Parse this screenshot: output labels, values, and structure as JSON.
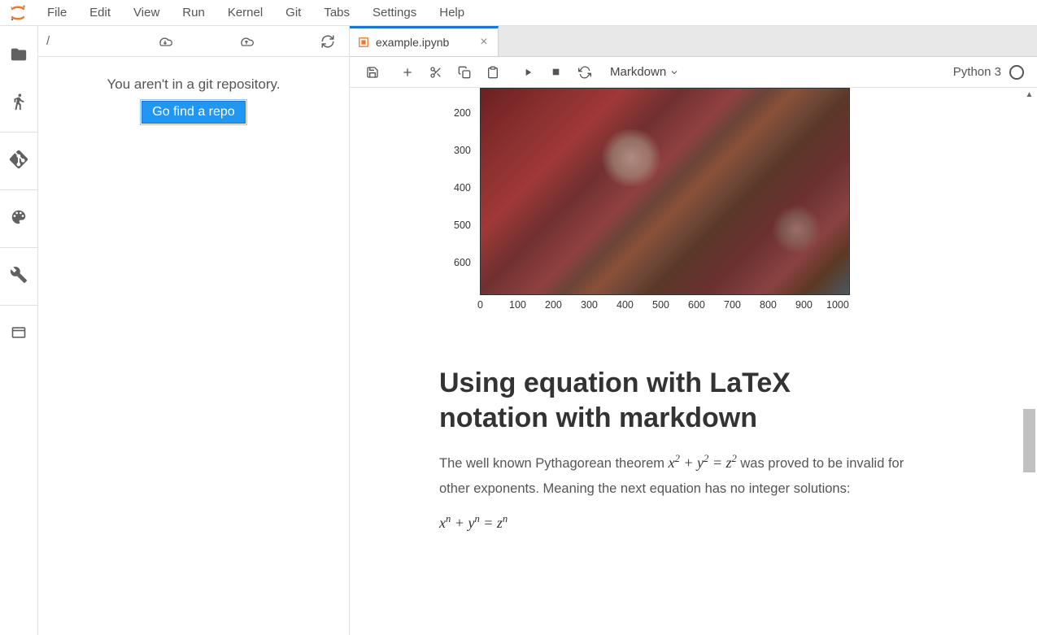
{
  "menu": {
    "items": [
      "File",
      "Edit",
      "View",
      "Run",
      "Kernel",
      "Git",
      "Tabs",
      "Settings",
      "Help"
    ]
  },
  "breadcrumb": "/",
  "git": {
    "message": "You aren't in a git repository.",
    "button": "Go find a repo"
  },
  "tab": {
    "label": "example.ipynb"
  },
  "toolbar": {
    "celltype": "Markdown",
    "kernel": "Python 3"
  },
  "notebook": {
    "heading": "Using equation with LaTeX notation with markdown",
    "paragraph_pre": "The well known Pythagorean theorem ",
    "paragraph_post": " was proved to be invalid for other exponents. Meaning the next equation has no integer solutions:"
  },
  "chart_data": {
    "type": "heatmap",
    "title": "",
    "xlabel": "",
    "ylabel": "",
    "xlim": [
      0,
      1050
    ],
    "ylim": [
      650,
      100
    ],
    "xticks": [
      0,
      100,
      200,
      300,
      400,
      500,
      600,
      700,
      800,
      900,
      1000
    ],
    "yticks_visible": [
      200,
      300,
      400,
      500,
      600
    ]
  }
}
